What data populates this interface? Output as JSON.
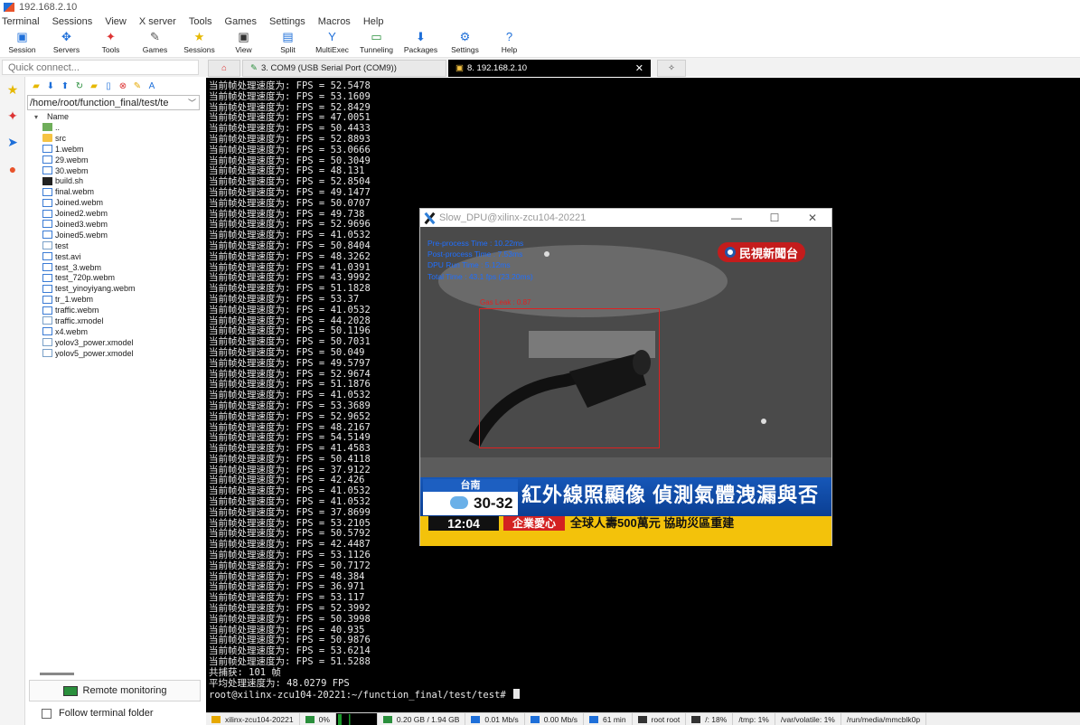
{
  "window": {
    "title": "192.168.2.10"
  },
  "menu": [
    "Terminal",
    "Sessions",
    "View",
    "X server",
    "Tools",
    "Games",
    "Settings",
    "Macros",
    "Help"
  ],
  "toolbar": [
    {
      "label": "Session",
      "icon": "session-icon",
      "glyph": "▣",
      "color": "#1e6fd9"
    },
    {
      "label": "Servers",
      "icon": "servers-icon",
      "glyph": "✥",
      "color": "#1e6fd9"
    },
    {
      "label": "Tools",
      "icon": "tools-icon",
      "glyph": "✦",
      "color": "#d33"
    },
    {
      "label": "Games",
      "icon": "games-icon",
      "glyph": "✎",
      "color": "#555"
    },
    {
      "label": "Sessions",
      "icon": "star-icon",
      "glyph": "★",
      "color": "#e6b800"
    },
    {
      "label": "View",
      "icon": "view-icon",
      "glyph": "▣",
      "color": "#333"
    },
    {
      "label": "Split",
      "icon": "split-icon",
      "glyph": "▤",
      "color": "#1e6fd9"
    },
    {
      "label": "MultiExec",
      "icon": "multiexec-icon",
      "glyph": "Y",
      "color": "#1e6fd9"
    },
    {
      "label": "Tunneling",
      "icon": "tunneling-icon",
      "glyph": "▭",
      "color": "#2a8f3c"
    },
    {
      "label": "Packages",
      "icon": "packages-icon",
      "glyph": "⬇",
      "color": "#1e6fd9"
    },
    {
      "label": "Settings",
      "icon": "settings-icon",
      "glyph": "⚙",
      "color": "#1e6fd9"
    },
    {
      "label": "Help",
      "icon": "help-icon",
      "glyph": "?",
      "color": "#1e6fd9"
    }
  ],
  "quick_connect": {
    "placeholder": "Quick connect..."
  },
  "tabs": {
    "com9": "3. COM9  (USB Serial Port (COM9))",
    "ssh": "8. 192.168.2.10",
    "close": "✕",
    "new": "✧"
  },
  "sidebar": {
    "path": "/home/root/function_final/test/te",
    "header": "Name",
    "files": [
      {
        "name": "..",
        "kind": "up"
      },
      {
        "name": "src",
        "kind": "folder"
      },
      {
        "name": "1.webm",
        "kind": "media"
      },
      {
        "name": "29.webm",
        "kind": "media"
      },
      {
        "name": "30.webm",
        "kind": "media"
      },
      {
        "name": "build.sh",
        "kind": "sh"
      },
      {
        "name": "final.webm",
        "kind": "media"
      },
      {
        "name": "Joined.webm",
        "kind": "media"
      },
      {
        "name": "Joined2.webm",
        "kind": "media"
      },
      {
        "name": "Joined3.webm",
        "kind": "media"
      },
      {
        "name": "Joined5.webm",
        "kind": "media"
      },
      {
        "name": "test",
        "kind": "doc"
      },
      {
        "name": "test.avi",
        "kind": "media"
      },
      {
        "name": "test_3.webm",
        "kind": "media"
      },
      {
        "name": "test_720p.webm",
        "kind": "media"
      },
      {
        "name": "test_yinoyiyang.webm",
        "kind": "media"
      },
      {
        "name": "tr_1.webm",
        "kind": "media"
      },
      {
        "name": "traffic.webm",
        "kind": "media"
      },
      {
        "name": "traffic.xmodel",
        "kind": "doc"
      },
      {
        "name": "x4.webm",
        "kind": "media"
      },
      {
        "name": "yolov3_power.xmodel",
        "kind": "doc"
      },
      {
        "name": "yolov5_power.xmodel",
        "kind": "doc"
      }
    ],
    "remote_monitoring": "Remote monitoring",
    "follow_terminal": "Follow terminal folder"
  },
  "terminal": {
    "line_prefix": "当前帧处理速度为: FPS = ",
    "fps_values": [
      "52.5478",
      "53.1609",
      "52.8429",
      "47.0051",
      "50.4433",
      "52.8893",
      "53.0666",
      "50.3049",
      "48.131",
      "52.8504",
      "49.1477",
      "50.0707",
      "49.738",
      "52.9696",
      "41.0532",
      "50.8404",
      "48.3262",
      "41.0391",
      "43.9992",
      "51.1828",
      "53.37",
      "41.0532",
      "44.2028",
      "50.1196",
      "50.7031",
      "50.049",
      "49.5797",
      "52.9674",
      "51.1876",
      "41.0532",
      "53.3689",
      "52.9652",
      "48.2167",
      "54.5149",
      "41.4583",
      "50.4118",
      "37.9122",
      "42.426",
      "41.0532",
      "41.0532",
      "37.8699",
      "53.2105",
      "50.5792",
      "42.4487",
      "53.1126",
      "50.7172",
      "48.384",
      "36.971",
      "53.117",
      "52.3992",
      "50.3998",
      "40.935",
      "50.9876",
      "53.6214",
      "51.5288"
    ],
    "total": "共捕获: 101 帧",
    "average": "平均处理速度为: 48.0279 FPS",
    "prompt": "root@xilinx-zcu104-20221:~/function_final/test/test# "
  },
  "popup": {
    "title": "Slow_DPU@xilinx-zcu104-20221",
    "controls": [
      "—",
      "☐",
      "✕"
    ],
    "overlay_lines": [
      "Pre-process Time : 10.22ms",
      "Post-process Time : 7.53ms",
      "DPU Run Time : 5.12ms",
      "Total Time : 43.1 fps (23.20ms)"
    ],
    "channel_logo": "民視新聞台",
    "detection_label": "Gas Leak : 0.87",
    "ticker": {
      "city": "台南",
      "temp": "30-32",
      "headline": "紅外線照顯像  偵測氣體洩漏與否",
      "time": "12:04",
      "tag": "企業愛心",
      "subline": "全球人壽500萬元 協助災區重建"
    }
  },
  "statusbar": [
    {
      "text": "xilinx-zcu104-20221",
      "icon": "warning-icon",
      "color": "#e6a800"
    },
    {
      "text": "0%",
      "icon": "cpu-icon",
      "color": "#2a8f3c"
    },
    {
      "text": "0.20 GB / 1.94 GB",
      "icon": "memory-icon",
      "color": "#2a8f3c"
    },
    {
      "text": "0.01 Mb/s",
      "icon": "upload-icon",
      "color": "#1e6fd9"
    },
    {
      "text": "0.00 Mb/s",
      "icon": "download-icon",
      "color": "#1e6fd9"
    },
    {
      "text": "61 min",
      "icon": "uptime-icon",
      "color": "#1e6fd9"
    },
    {
      "text": "root  root",
      "icon": "user-icon",
      "color": "#333"
    },
    {
      "text": "/: 18%",
      "icon": "disk-icon",
      "color": "#333"
    },
    {
      "text": "/tmp: 1%",
      "icon": "",
      "color": ""
    },
    {
      "text": "/var/volatile: 1%",
      "icon": "",
      "color": ""
    },
    {
      "text": "/run/media/mmcblk0p",
      "icon": "",
      "color": ""
    }
  ]
}
